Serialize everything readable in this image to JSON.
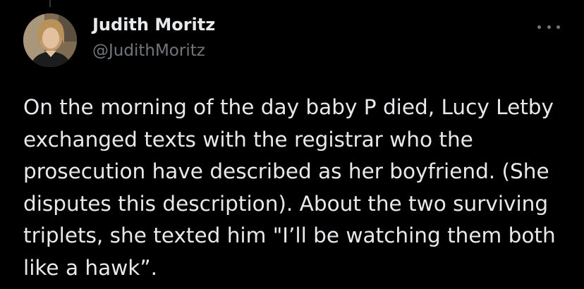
{
  "tweet": {
    "author": {
      "display_name": "Judith Moritz",
      "handle": "@JudithMoritz",
      "avatar_icon": "profile-photo"
    },
    "more_icon": "more-options-icon",
    "text": "On the morning of the day baby P died, Lucy Letby\nexchanged texts with the registrar who the\nprosecution have described as her boyfriend. (She\ndisputes this description). About the two surviving\ntriplets, she texted him \"I’ll be watching them both\nlike a hawk”."
  },
  "colors": {
    "background": "#000000",
    "primary_text": "#e7e9ea",
    "secondary_text": "#71767b"
  }
}
